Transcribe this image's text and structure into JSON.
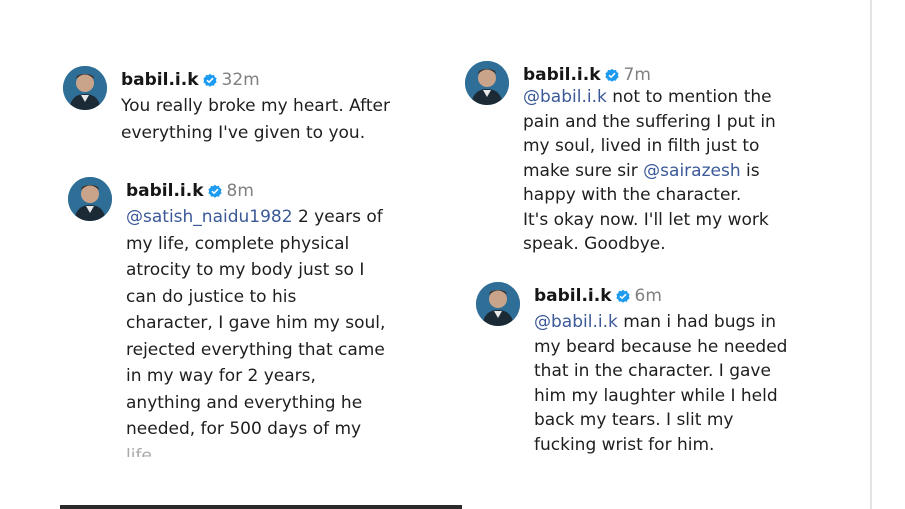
{
  "comments": [
    {
      "username": "babil.i.k",
      "time": "32m",
      "lines": [
        "You really broke my heart. After",
        "everything I've given to you."
      ]
    },
    {
      "username": "babil.i.k",
      "time": "8m",
      "mention": "@satish_naidu1982",
      "first_line_rest": " 2 years of",
      "lines": [
        "my life, complete physical",
        "atrocity to my body just so I",
        "can do justice to his",
        "character, I gave him my soul,",
        "rejected everything that came",
        "in my way for 2 years,",
        "anything and everything he",
        "needed, for 500 days of my"
      ],
      "cut_line": "life"
    },
    {
      "username": "babil.i.k",
      "time": "7m",
      "mention": "@babil.i.k",
      "first_line_rest": " not to mention the",
      "lines": [
        "pain and the suffering I put in",
        "my soul, lived in filth just to"
      ],
      "line_before_mention": "make sure sir ",
      "mention2": "@sairazesh",
      "line_after_mention": " is",
      "lines2": [
        "happy with the character.",
        "It's okay now. I'll let my work",
        "speak. Goodbye."
      ]
    },
    {
      "username": "babil.i.k",
      "time": "6m",
      "mention": "@babil.i.k",
      "first_line_rest": " man i had bugs in",
      "lines": [
        "my beard because he needed",
        "that in the character. I gave",
        "him my laughter while I held",
        "back my tears. I slit my",
        "fucking wrist for him."
      ]
    }
  ],
  "colors": {
    "mention": "#3b5998",
    "verified": "#1d9bf0",
    "time": "#808080"
  },
  "icons": {
    "verified": "verified-badge-icon",
    "avatar": "profile-avatar"
  }
}
